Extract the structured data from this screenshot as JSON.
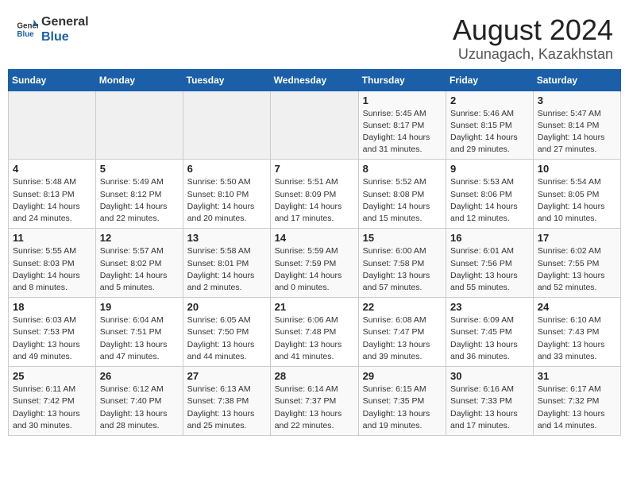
{
  "header": {
    "logo_general": "General",
    "logo_blue": "Blue",
    "title": "August 2024",
    "subtitle": "Uzunagach, Kazakhstan"
  },
  "weekdays": [
    "Sunday",
    "Monday",
    "Tuesday",
    "Wednesday",
    "Thursday",
    "Friday",
    "Saturday"
  ],
  "weeks": [
    [
      {
        "day": "",
        "info": ""
      },
      {
        "day": "",
        "info": ""
      },
      {
        "day": "",
        "info": ""
      },
      {
        "day": "",
        "info": ""
      },
      {
        "day": "1",
        "info": "Sunrise: 5:45 AM\nSunset: 8:17 PM\nDaylight: 14 hours\nand 31 minutes."
      },
      {
        "day": "2",
        "info": "Sunrise: 5:46 AM\nSunset: 8:15 PM\nDaylight: 14 hours\nand 29 minutes."
      },
      {
        "day": "3",
        "info": "Sunrise: 5:47 AM\nSunset: 8:14 PM\nDaylight: 14 hours\nand 27 minutes."
      }
    ],
    [
      {
        "day": "4",
        "info": "Sunrise: 5:48 AM\nSunset: 8:13 PM\nDaylight: 14 hours\nand 24 minutes."
      },
      {
        "day": "5",
        "info": "Sunrise: 5:49 AM\nSunset: 8:12 PM\nDaylight: 14 hours\nand 22 minutes."
      },
      {
        "day": "6",
        "info": "Sunrise: 5:50 AM\nSunset: 8:10 PM\nDaylight: 14 hours\nand 20 minutes."
      },
      {
        "day": "7",
        "info": "Sunrise: 5:51 AM\nSunset: 8:09 PM\nDaylight: 14 hours\nand 17 minutes."
      },
      {
        "day": "8",
        "info": "Sunrise: 5:52 AM\nSunset: 8:08 PM\nDaylight: 14 hours\nand 15 minutes."
      },
      {
        "day": "9",
        "info": "Sunrise: 5:53 AM\nSunset: 8:06 PM\nDaylight: 14 hours\nand 12 minutes."
      },
      {
        "day": "10",
        "info": "Sunrise: 5:54 AM\nSunset: 8:05 PM\nDaylight: 14 hours\nand 10 minutes."
      }
    ],
    [
      {
        "day": "11",
        "info": "Sunrise: 5:55 AM\nSunset: 8:03 PM\nDaylight: 14 hours\nand 8 minutes."
      },
      {
        "day": "12",
        "info": "Sunrise: 5:57 AM\nSunset: 8:02 PM\nDaylight: 14 hours\nand 5 minutes."
      },
      {
        "day": "13",
        "info": "Sunrise: 5:58 AM\nSunset: 8:01 PM\nDaylight: 14 hours\nand 2 minutes."
      },
      {
        "day": "14",
        "info": "Sunrise: 5:59 AM\nSunset: 7:59 PM\nDaylight: 14 hours\nand 0 minutes."
      },
      {
        "day": "15",
        "info": "Sunrise: 6:00 AM\nSunset: 7:58 PM\nDaylight: 13 hours\nand 57 minutes."
      },
      {
        "day": "16",
        "info": "Sunrise: 6:01 AM\nSunset: 7:56 PM\nDaylight: 13 hours\nand 55 minutes."
      },
      {
        "day": "17",
        "info": "Sunrise: 6:02 AM\nSunset: 7:55 PM\nDaylight: 13 hours\nand 52 minutes."
      }
    ],
    [
      {
        "day": "18",
        "info": "Sunrise: 6:03 AM\nSunset: 7:53 PM\nDaylight: 13 hours\nand 49 minutes."
      },
      {
        "day": "19",
        "info": "Sunrise: 6:04 AM\nSunset: 7:51 PM\nDaylight: 13 hours\nand 47 minutes."
      },
      {
        "day": "20",
        "info": "Sunrise: 6:05 AM\nSunset: 7:50 PM\nDaylight: 13 hours\nand 44 minutes."
      },
      {
        "day": "21",
        "info": "Sunrise: 6:06 AM\nSunset: 7:48 PM\nDaylight: 13 hours\nand 41 minutes."
      },
      {
        "day": "22",
        "info": "Sunrise: 6:08 AM\nSunset: 7:47 PM\nDaylight: 13 hours\nand 39 minutes."
      },
      {
        "day": "23",
        "info": "Sunrise: 6:09 AM\nSunset: 7:45 PM\nDaylight: 13 hours\nand 36 minutes."
      },
      {
        "day": "24",
        "info": "Sunrise: 6:10 AM\nSunset: 7:43 PM\nDaylight: 13 hours\nand 33 minutes."
      }
    ],
    [
      {
        "day": "25",
        "info": "Sunrise: 6:11 AM\nSunset: 7:42 PM\nDaylight: 13 hours\nand 30 minutes."
      },
      {
        "day": "26",
        "info": "Sunrise: 6:12 AM\nSunset: 7:40 PM\nDaylight: 13 hours\nand 28 minutes."
      },
      {
        "day": "27",
        "info": "Sunrise: 6:13 AM\nSunset: 7:38 PM\nDaylight: 13 hours\nand 25 minutes."
      },
      {
        "day": "28",
        "info": "Sunrise: 6:14 AM\nSunset: 7:37 PM\nDaylight: 13 hours\nand 22 minutes."
      },
      {
        "day": "29",
        "info": "Sunrise: 6:15 AM\nSunset: 7:35 PM\nDaylight: 13 hours\nand 19 minutes."
      },
      {
        "day": "30",
        "info": "Sunrise: 6:16 AM\nSunset: 7:33 PM\nDaylight: 13 hours\nand 17 minutes."
      },
      {
        "day": "31",
        "info": "Sunrise: 6:17 AM\nSunset: 7:32 PM\nDaylight: 13 hours\nand 14 minutes."
      }
    ]
  ]
}
